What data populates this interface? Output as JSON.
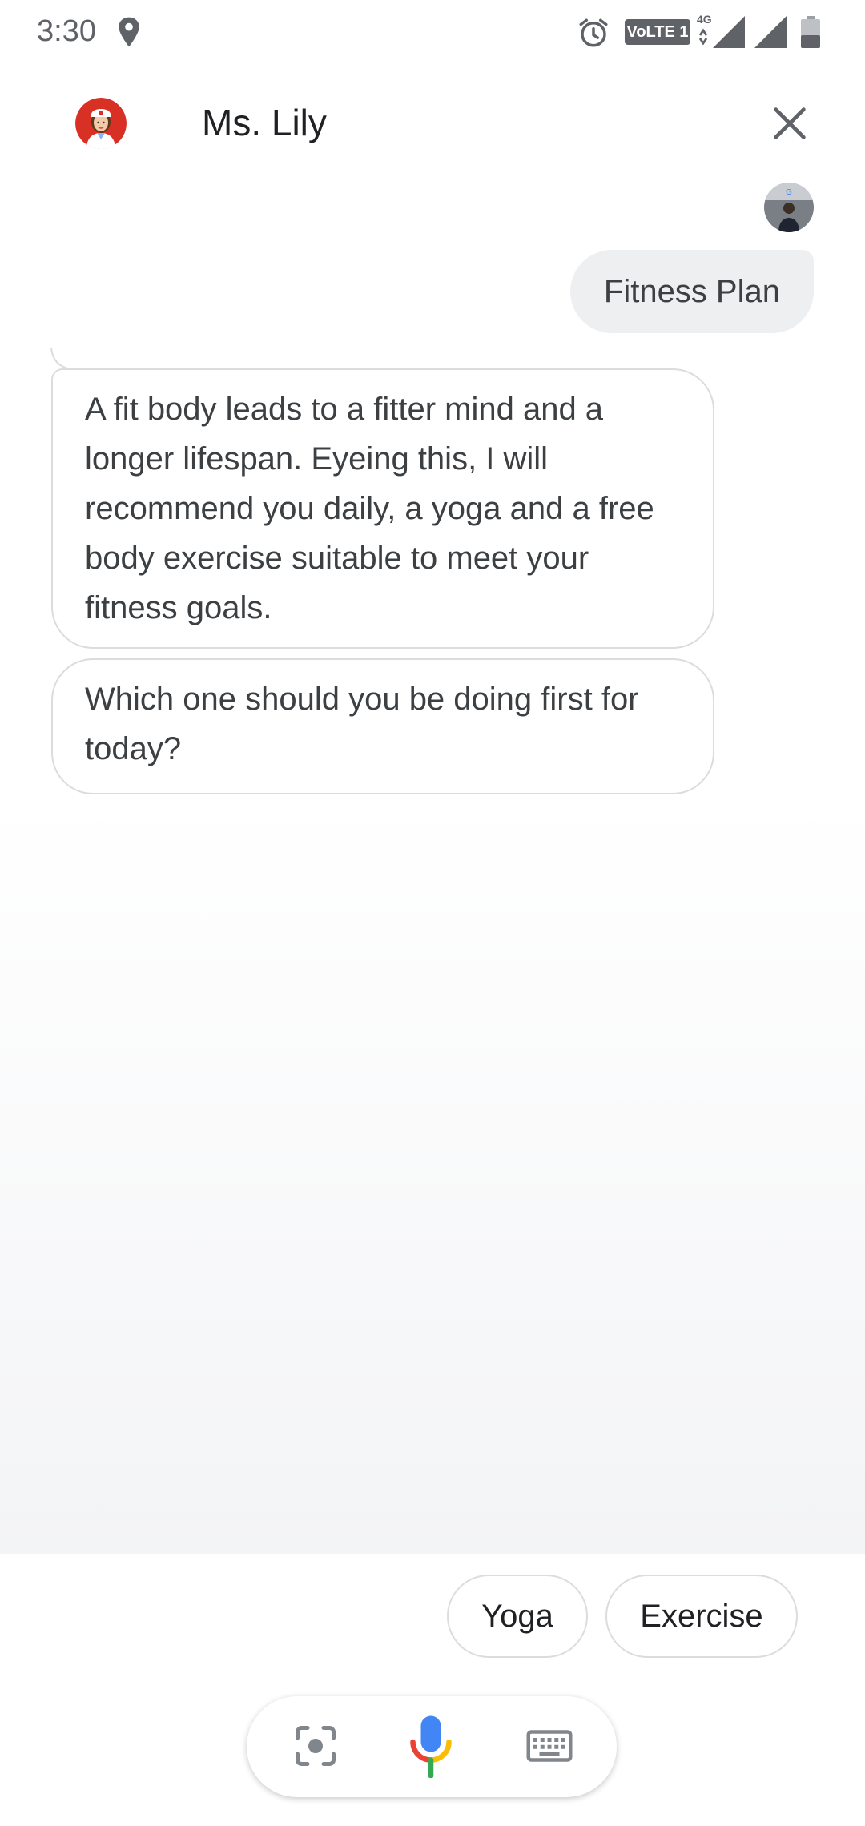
{
  "status_bar": {
    "time": "3:30",
    "volte_label": "VoLTE 1",
    "network_label": "4G"
  },
  "header": {
    "agent_name": "Ms. Lily"
  },
  "conversation": {
    "user_message": "Fitness Plan",
    "agent_messages": [
      "A fit body leads to a fitter mind and a longer lifespan. Eyeing this, I will recommend you daily, a yoga and a free body exercise suitable to meet your fitness goals.",
      "Which one should you be doing first for today?"
    ]
  },
  "suggestions": [
    "Yoga",
    "Exercise"
  ],
  "input_bar": {
    "icons": [
      "lens-icon",
      "microphone-icon",
      "keyboard-icon"
    ]
  },
  "colors": {
    "mic_blue": "#4285F4",
    "mic_red": "#EA4335",
    "mic_yellow": "#FBBC05",
    "mic_green": "#34A853",
    "avatar_red": "#d93025"
  }
}
